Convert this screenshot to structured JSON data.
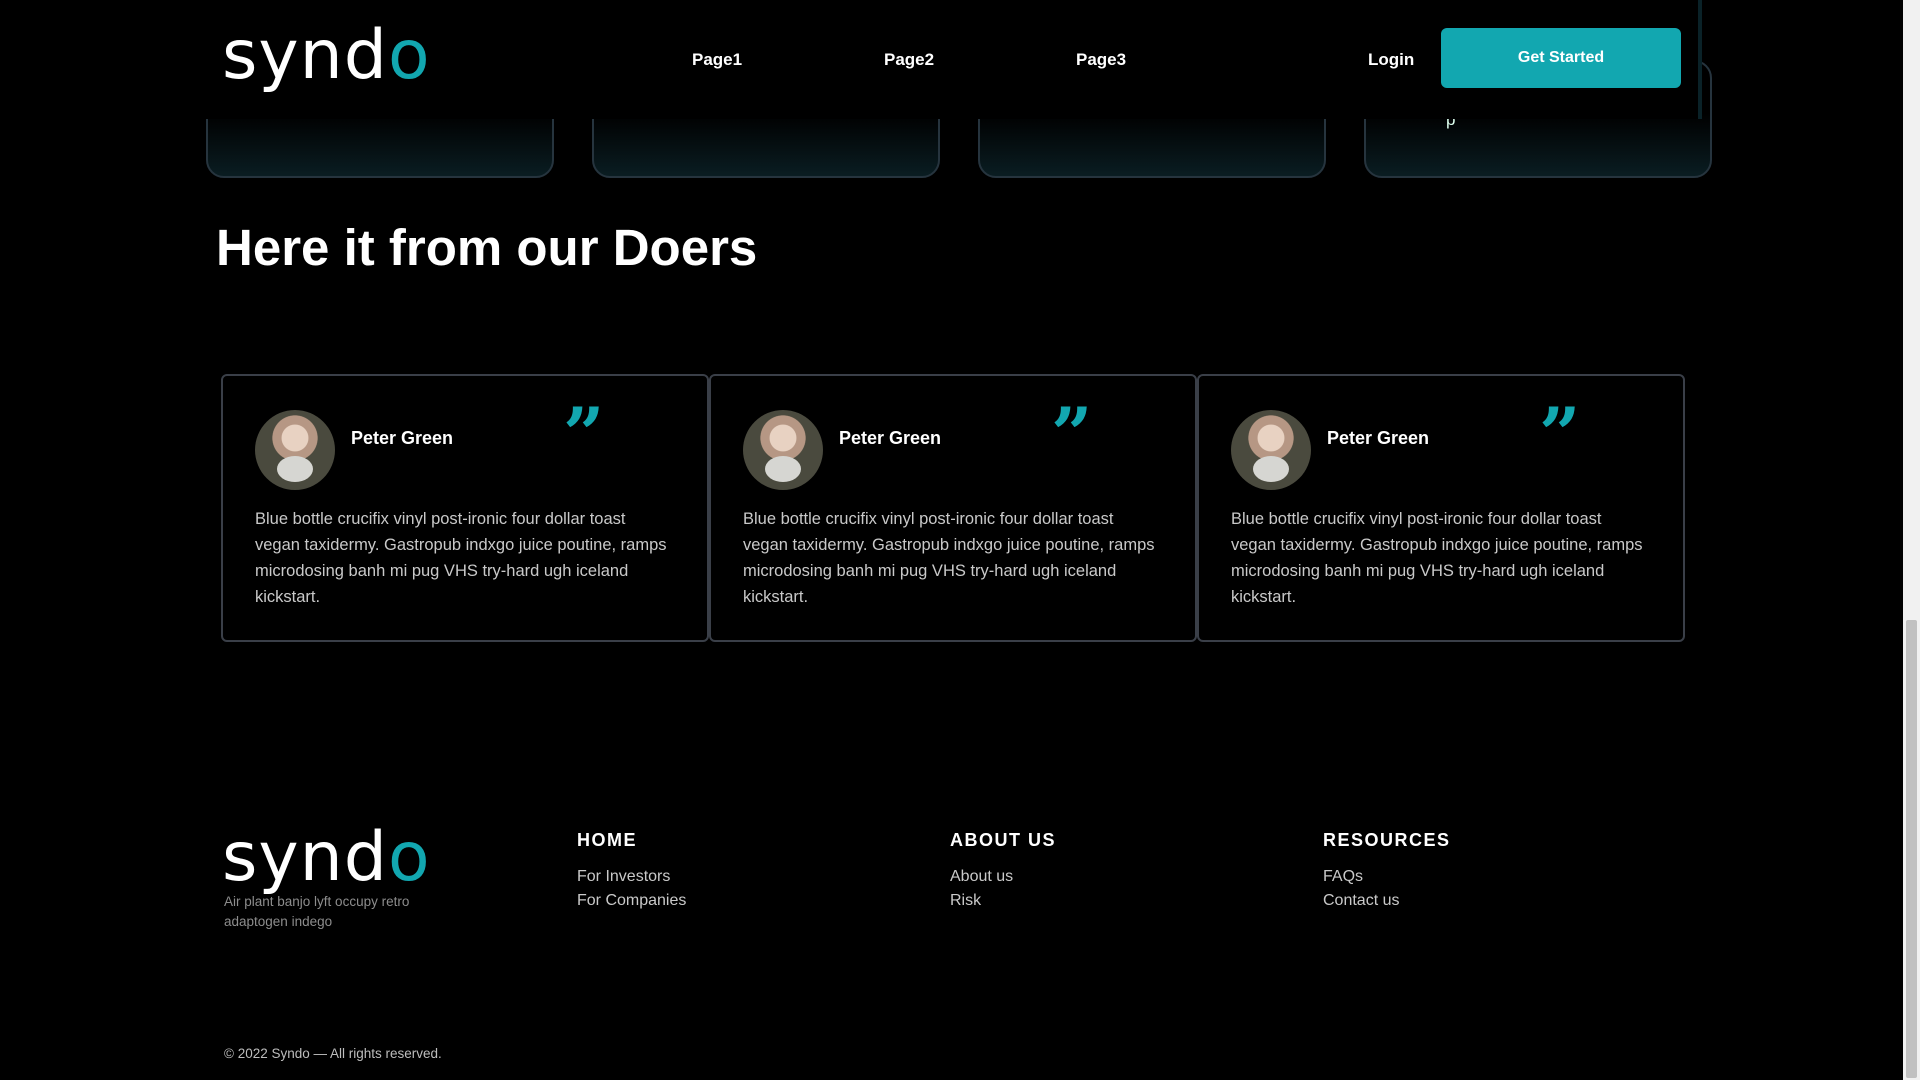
{
  "header": {
    "logo": {
      "main": "synd",
      "accent": "o"
    },
    "nav": [
      "Page1",
      "Page2",
      "Page3"
    ],
    "login": "Login",
    "cta": "Get Started"
  },
  "feature_cards": {
    "card4_text": "p"
  },
  "section": {
    "title": "Here it from our Doers"
  },
  "testimonials": [
    {
      "name": "Peter Green",
      "quote_mark": "”",
      "text": "Blue bottle crucifix vinyl post-ironic four dollar toast vegan taxidermy. Gastropub indxgo juice poutine, ramps microdosing banh mi pug VHS try-hard ugh iceland kickstart."
    },
    {
      "name": "Peter Green",
      "quote_mark": "”",
      "text": "Blue bottle crucifix vinyl post-ironic four dollar toast vegan taxidermy. Gastropub indxgo juice poutine, ramps microdosing banh mi pug VHS try-hard ugh iceland kickstart."
    },
    {
      "name": "Peter Green",
      "quote_mark": "”",
      "text": "Blue bottle crucifix vinyl post-ironic four dollar toast vegan taxidermy. Gastropub indxgo juice poutine, ramps microdosing banh mi pug VHS try-hard ugh iceland kickstart."
    }
  ],
  "footer": {
    "logo": {
      "main": "synd",
      "accent": "o"
    },
    "tagline": "Air plant banjo lyft occupy retro adaptogen indego",
    "columns": [
      {
        "heading": "HOME",
        "links": [
          "For Investors",
          "For Companies"
        ]
      },
      {
        "heading": "ABOUT US",
        "links": [
          "About us",
          "Risk"
        ]
      },
      {
        "heading": "RESOURCES",
        "links": [
          "FAQs",
          "Contact us"
        ]
      }
    ],
    "copyright": "© 2022 Syndo — All rights reserved."
  },
  "colors": {
    "accent": "#12a7b0",
    "background": "#000000"
  },
  "icons": {
    "quote": "quote-icon",
    "avatar": "avatar"
  }
}
